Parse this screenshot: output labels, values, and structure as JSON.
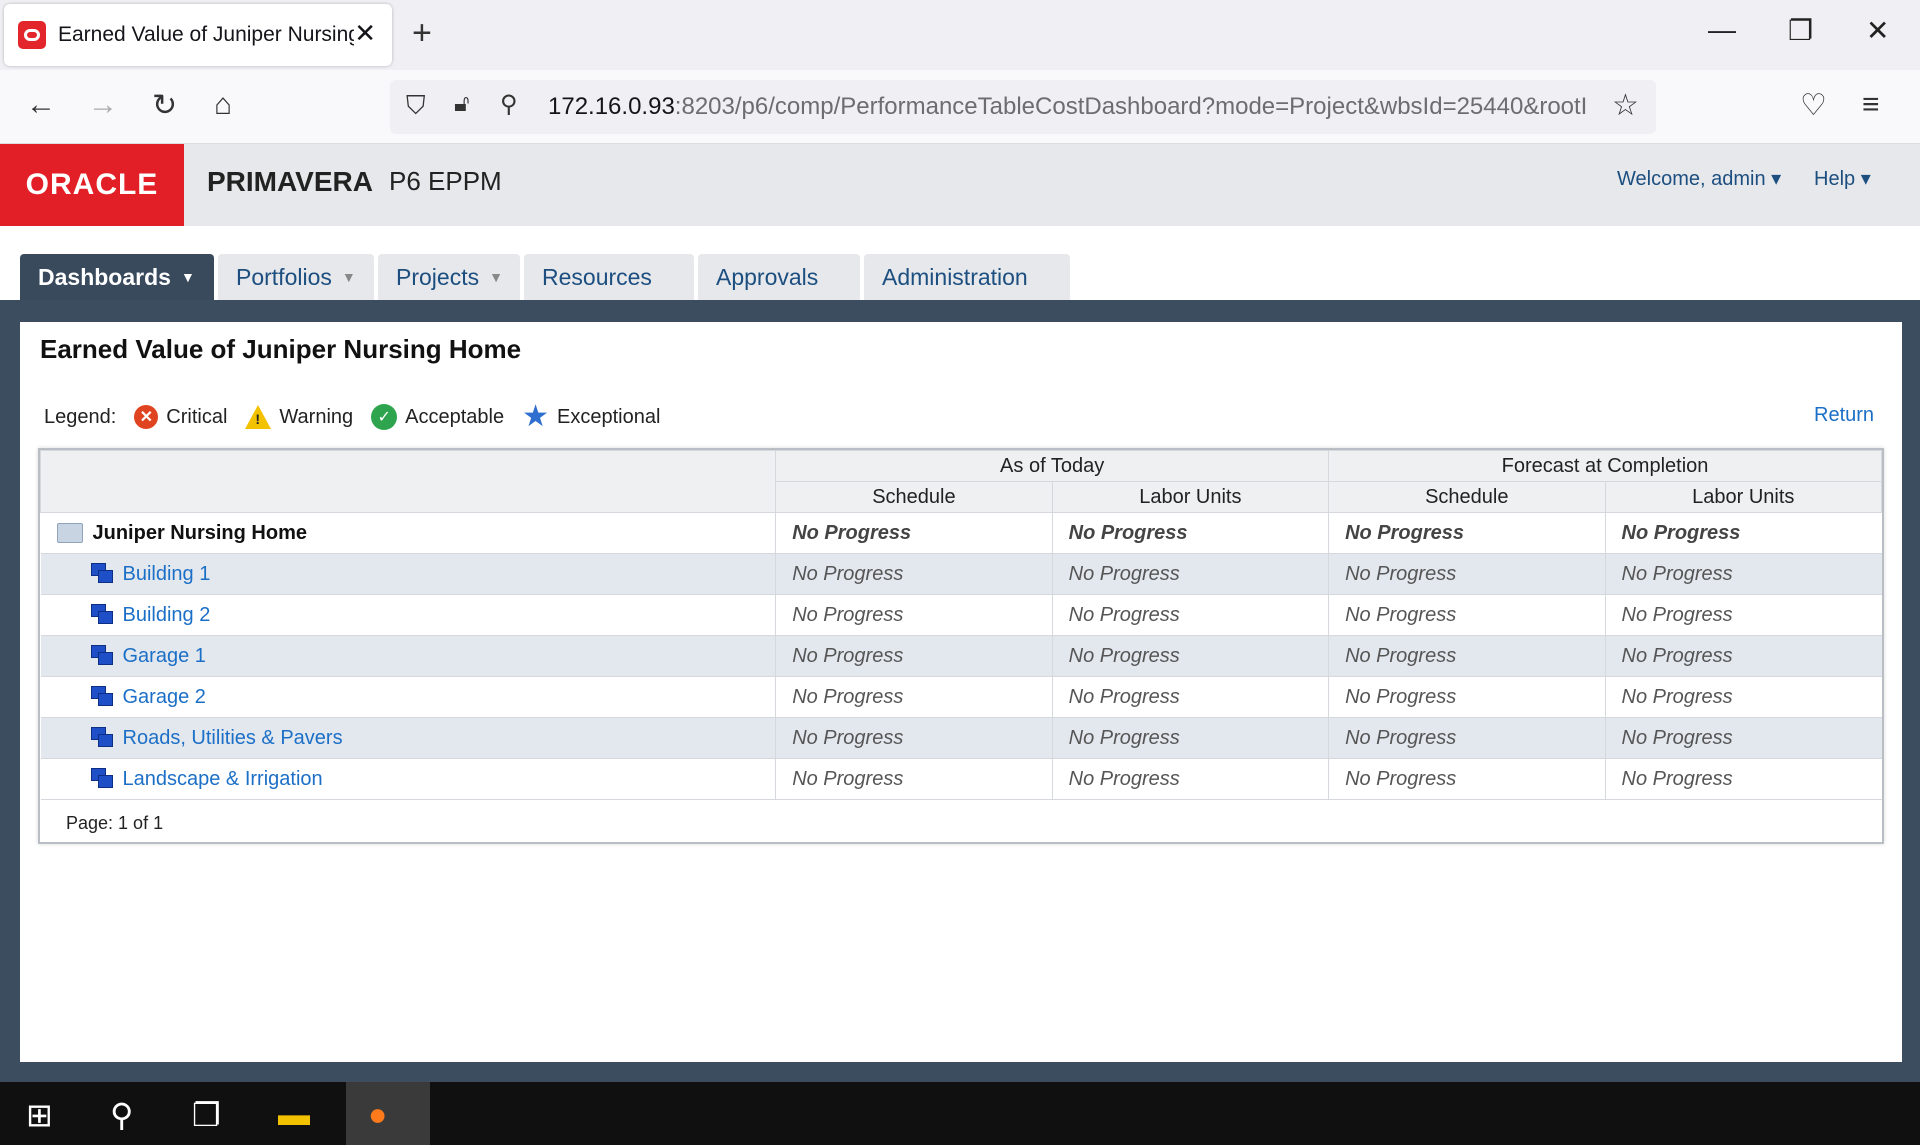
{
  "browser": {
    "tab_title": "Earned Value of Juniper Nursing Home",
    "tab_close": "✕",
    "new_tab": "+",
    "window_controls": {
      "minimize": "—",
      "restore": "❐",
      "close": "✕"
    },
    "url_host": "172.16.0.93",
    "url_rest": ":8203/p6/comp/PerformanceTableCostDashboard?mode=Project&wbsId=25440&rootI"
  },
  "header": {
    "logo": "ORACLE",
    "product": "PRIMAVERA",
    "product_suffix": "P6 EPPM",
    "welcome": "Welcome, admin ▾",
    "help": "Help ▾"
  },
  "nav": {
    "tabs": [
      {
        "label": "Dashboards",
        "active": true,
        "has_menu": true
      },
      {
        "label": "Portfolios",
        "active": false,
        "has_menu": true
      },
      {
        "label": "Projects",
        "active": false,
        "has_menu": true
      },
      {
        "label": "Resources",
        "active": false,
        "has_menu": false
      },
      {
        "label": "Approvals",
        "active": false,
        "has_menu": false
      },
      {
        "label": "Administration",
        "active": false,
        "has_menu": false
      }
    ]
  },
  "page": {
    "title": "Earned Value of Juniper Nursing Home",
    "return_link": "Return",
    "legend": {
      "label": "Legend:",
      "items": [
        {
          "label": "Critical",
          "icon": "critical-icon"
        },
        {
          "label": "Warning",
          "icon": "warning-icon"
        },
        {
          "label": "Acceptable",
          "icon": "acceptable-icon"
        },
        {
          "label": "Exceptional",
          "icon": "star-icon"
        }
      ]
    }
  },
  "table": {
    "group_headers": [
      "As of Today",
      "Forecast at Completion"
    ],
    "sub_headers": [
      "Schedule",
      "Labor Units",
      "Schedule",
      "Labor Units"
    ],
    "root": {
      "name": "Juniper Nursing Home",
      "values": [
        "No Progress",
        "No Progress",
        "No Progress",
        "No Progress"
      ]
    },
    "rows": [
      {
        "name": "Building 1",
        "values": [
          "No Progress",
          "No Progress",
          "No Progress",
          "No Progress"
        ]
      },
      {
        "name": "Building 2",
        "values": [
          "No Progress",
          "No Progress",
          "No Progress",
          "No Progress"
        ]
      },
      {
        "name": "Garage 1",
        "values": [
          "No Progress",
          "No Progress",
          "No Progress",
          "No Progress"
        ]
      },
      {
        "name": "Garage 2",
        "values": [
          "No Progress",
          "No Progress",
          "No Progress",
          "No Progress"
        ]
      },
      {
        "name": "Roads, Utilities & Pavers",
        "values": [
          "No Progress",
          "No Progress",
          "No Progress",
          "No Progress"
        ]
      },
      {
        "name": "Landscape & Irrigation",
        "values": [
          "No Progress",
          "No Progress",
          "No Progress",
          "No Progress"
        ]
      }
    ],
    "pager": "Page: 1 of 1"
  },
  "colors": {
    "oracle_red": "#e21f26",
    "active_tab": "#3a4a5d",
    "link": "#1c6fc6",
    "alt_row": "#e3e8ef"
  }
}
